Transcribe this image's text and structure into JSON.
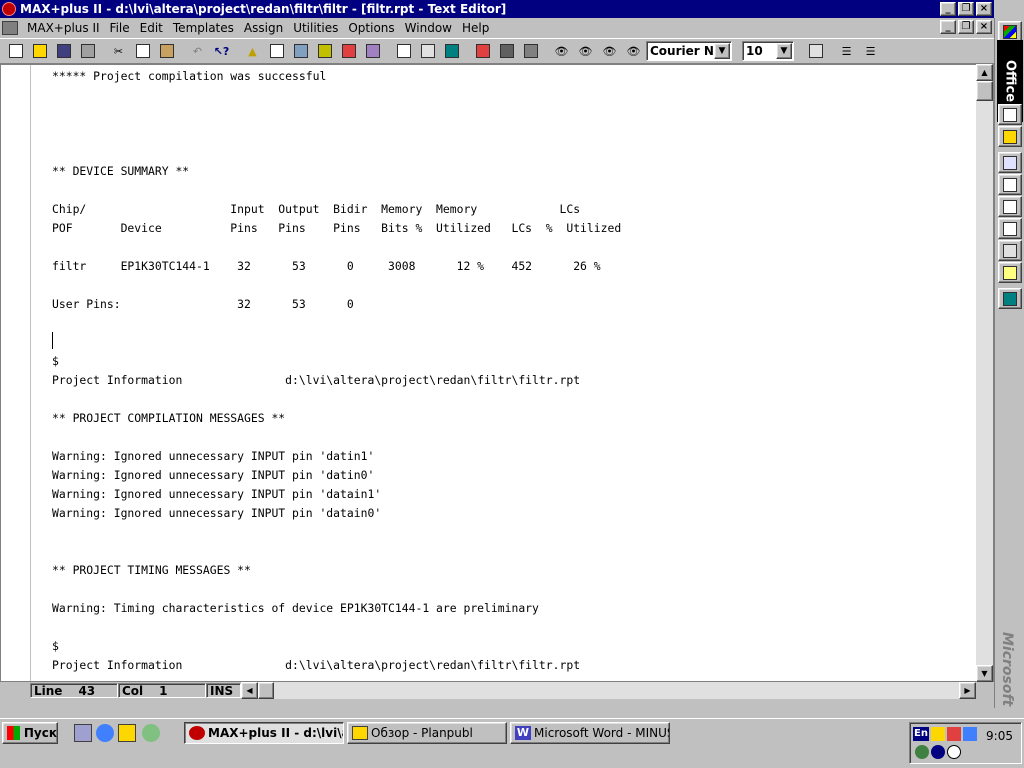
{
  "window": {
    "title": "MAX+plus II - d:\\lvi\\altera\\project\\redan\\filtr\\filtr - [filtr.rpt - Text Editor]",
    "colors": {
      "titlebar": "#000080",
      "face": "#c0c0c0"
    }
  },
  "menubar": {
    "items": [
      "MAX+plus II",
      "File",
      "Edit",
      "Templates",
      "Assign",
      "Utilities",
      "Options",
      "Window",
      "Help"
    ]
  },
  "toolbar": {
    "font_name": "Courier Ne",
    "font_size": "10",
    "icons": [
      "new-file-icon",
      "open-file-icon",
      "save-icon",
      "print-icon",
      "cut-icon",
      "copy-icon",
      "paste-icon",
      "undo-icon",
      "context-help-icon",
      "hierarchy-display-icon",
      "floorplan-editor-icon",
      "compiler-icon",
      "simulator-icon",
      "timing-analyzer-icon",
      "programmer-icon",
      "open-project-icon",
      "save-project-icon",
      "project-top-icon",
      "save-check-icon",
      "save-compile-icon",
      "save-simulate-icon",
      "find-icon",
      "find-replace-icon",
      "find-next-icon",
      "find-matching-icon"
    ]
  },
  "editor": {
    "lines": [
      "***** Project compilation was successful",
      "",
      "",
      "",
      "",
      "** DEVICE SUMMARY **",
      "",
      "Chip/                     Input  Output  Bidir  Memory  Memory            LCs",
      "POF       Device          Pins   Pins    Pins   Bits %  Utilized   LCs  %  Utilized",
      "",
      "filtr     EP1K30TC144-1    32      53      0     3008      12 %    452      26 %",
      "",
      "User Pins:                 32      53      0",
      "",
      "",
      "$",
      "Project Information               d:\\lvi\\altera\\project\\redan\\filtr\\filtr.rpt",
      "",
      "** PROJECT COMPILATION MESSAGES **",
      "",
      "Warning: Ignored unnecessary INPUT pin 'datin1'",
      "Warning: Ignored unnecessary INPUT pin 'datin0'",
      "Warning: Ignored unnecessary INPUT pin 'datain1'",
      "Warning: Ignored unnecessary INPUT pin 'datain0'",
      "",
      "",
      "** PROJECT TIMING MESSAGES **",
      "",
      "Warning: Timing characteristics of device EP1K30TC144-1 are preliminary",
      "",
      "$",
      "Project Information               d:\\lvi\\altera\\project\\redan\\filtr\\filtr.rpt"
    ]
  },
  "statusbar": {
    "line_label": "Line",
    "line_value": "43",
    "col_label": "Col",
    "col_value": "1",
    "mode": "INS"
  },
  "office_bar": {
    "title": "Office",
    "brand": "Microsoft"
  },
  "taskbar": {
    "start_label": "Пуск",
    "tasks": [
      {
        "label": "MAX+plus II - d:\\lvi\\a...",
        "active": true
      },
      {
        "label": "Обзор - Planpubl",
        "active": false
      },
      {
        "label": "Microsoft Word - MINUSM...",
        "active": false
      }
    ],
    "tray_lang": "En",
    "clock": "9:05"
  }
}
